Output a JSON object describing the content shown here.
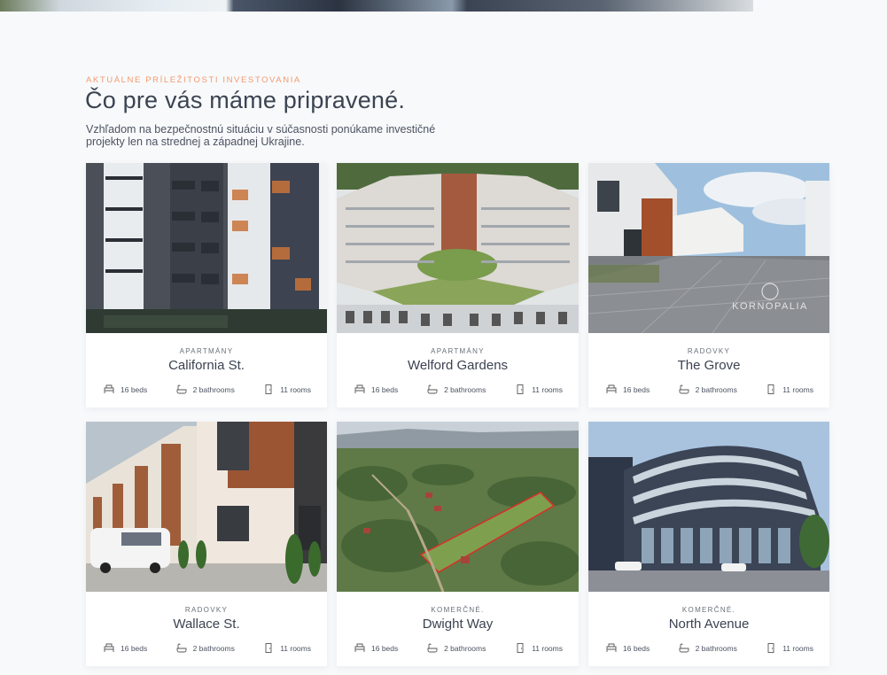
{
  "section": {
    "eyebrow": "AKTUÁLNE PRÍLEŽITOSTI INVESTOVANIA",
    "title": "Čo pre vás máme pripravené.",
    "intro": "Vzhľadom na bezpečnostnú situáciu v súčasnosti ponúkame investičné projekty len na strednej a západnej Ukrajine."
  },
  "icons": {
    "beds": "bed-icon",
    "baths": "bathtub-icon",
    "rooms": "door-icon"
  },
  "cards": [
    {
      "category": "APARTMÁNY",
      "title": "California St.",
      "beds": "16 beds",
      "baths": "2 bathrooms",
      "rooms": "11 rooms",
      "image": "apartment-tower-photo"
    },
    {
      "category": "APARTMÁNY",
      "title": "Welford Gardens",
      "beds": "16 beds",
      "baths": "2 bathrooms",
      "rooms": "11 rooms",
      "image": "courtyard-complex-render"
    },
    {
      "category": "RADOVKY",
      "title": "The Grove",
      "beds": "16 beds",
      "baths": "2 bathrooms",
      "rooms": "11 rooms",
      "image": "modern-townhouses-photo",
      "watermark": "KORNOPALIA"
    },
    {
      "category": "RADOVKY",
      "title": "Wallace St.",
      "beds": "16 beds",
      "baths": "2 bathrooms",
      "rooms": "11 rooms",
      "image": "brick-townhouses-photo"
    },
    {
      "category": "KOMERČNÉ.",
      "title": "Dwight Way",
      "beds": "16 beds",
      "baths": "2 bathrooms",
      "rooms": "11 rooms",
      "image": "aerial-land-plot-photo"
    },
    {
      "category": "KOMERČNÉ.",
      "title": "North Avenue",
      "beds": "16 beds",
      "baths": "2 bathrooms",
      "rooms": "11 rooms",
      "image": "commercial-building-render"
    }
  ]
}
